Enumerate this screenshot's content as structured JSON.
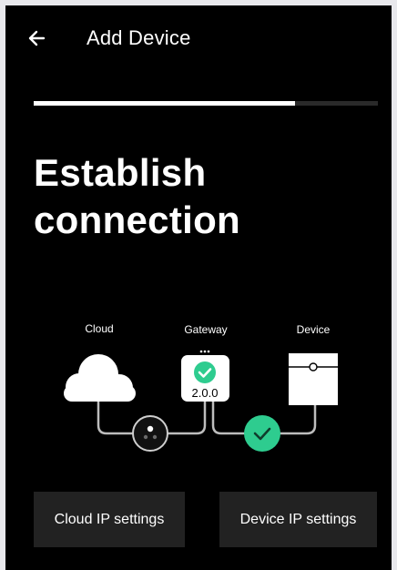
{
  "header": {
    "title": "Add Device",
    "back_icon": "arrow-left-icon"
  },
  "progress": {
    "value": 0.76
  },
  "headline": {
    "line1": "Establish",
    "line2": "connection"
  },
  "diagram": {
    "cloud_label": "Cloud",
    "gateway_label": "Gateway",
    "device_label": "Device",
    "gateway_version": "2.0.0",
    "status_color": "#2ecc8f"
  },
  "buttons": {
    "cloud_ip": "Cloud IP settings",
    "device_ip": "Device IP settings"
  }
}
